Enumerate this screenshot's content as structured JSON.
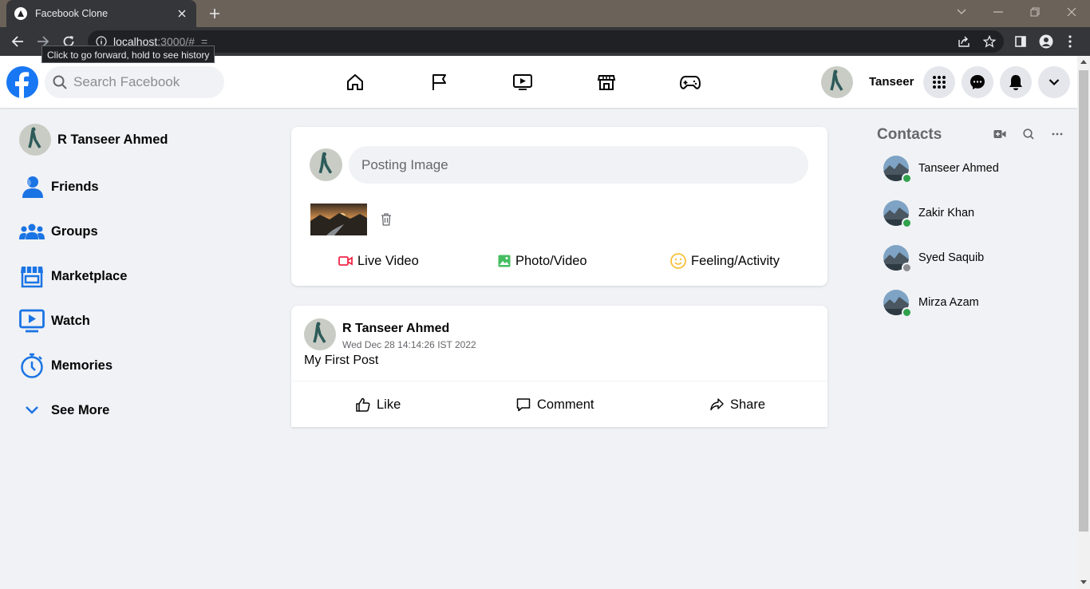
{
  "browser": {
    "tab_title": "Facebook Clone",
    "url_host": "localhost",
    "url_rest": ":3000/#",
    "url_suffix": "=",
    "tooltip": "Click to go forward, hold to see history"
  },
  "header": {
    "search_placeholder": "Search Facebook",
    "username": "Tanseer",
    "brand_color": "#1877f2"
  },
  "sidebar": {
    "profile_name": "R Tanseer Ahmed",
    "items": [
      {
        "label": "Friends",
        "icon": "friends-icon"
      },
      {
        "label": "Groups",
        "icon": "groups-icon"
      },
      {
        "label": "Marketplace",
        "icon": "marketplace-icon"
      },
      {
        "label": "Watch",
        "icon": "watch-icon"
      },
      {
        "label": "Memories",
        "icon": "memories-icon"
      },
      {
        "label": "See More",
        "icon": "chevron-down-icon"
      }
    ]
  },
  "composer": {
    "input_value": "Posting Image",
    "options": [
      {
        "label": "Live Video",
        "icon": "live-video-icon",
        "color": "#f02849"
      },
      {
        "label": "Photo/Video",
        "icon": "photo-video-icon",
        "color": "#45bd62"
      },
      {
        "label": "Feeling/Activity",
        "icon": "feeling-icon",
        "color": "#f7b928"
      }
    ]
  },
  "post": {
    "author": "R Tanseer Ahmed",
    "timestamp": "Wed Dec 28 14:14:26 IST 2022",
    "text": "My First Post",
    "actions": [
      {
        "label": "Like",
        "icon": "like-icon"
      },
      {
        "label": "Comment",
        "icon": "comment-icon"
      },
      {
        "label": "Share",
        "icon": "share-icon"
      }
    ]
  },
  "contacts": {
    "title": "Contacts",
    "list": [
      {
        "name": "Tanseer Ahmed",
        "status": "online",
        "status_color": "#31a24c"
      },
      {
        "name": "Zakir Khan",
        "status": "online",
        "status_color": "#31a24c"
      },
      {
        "name": "Syed Saquib",
        "status": "offline",
        "status_color": "#8a8d91"
      },
      {
        "name": "Mirza Azam",
        "status": "online",
        "status_color": "#31a24c"
      }
    ]
  }
}
